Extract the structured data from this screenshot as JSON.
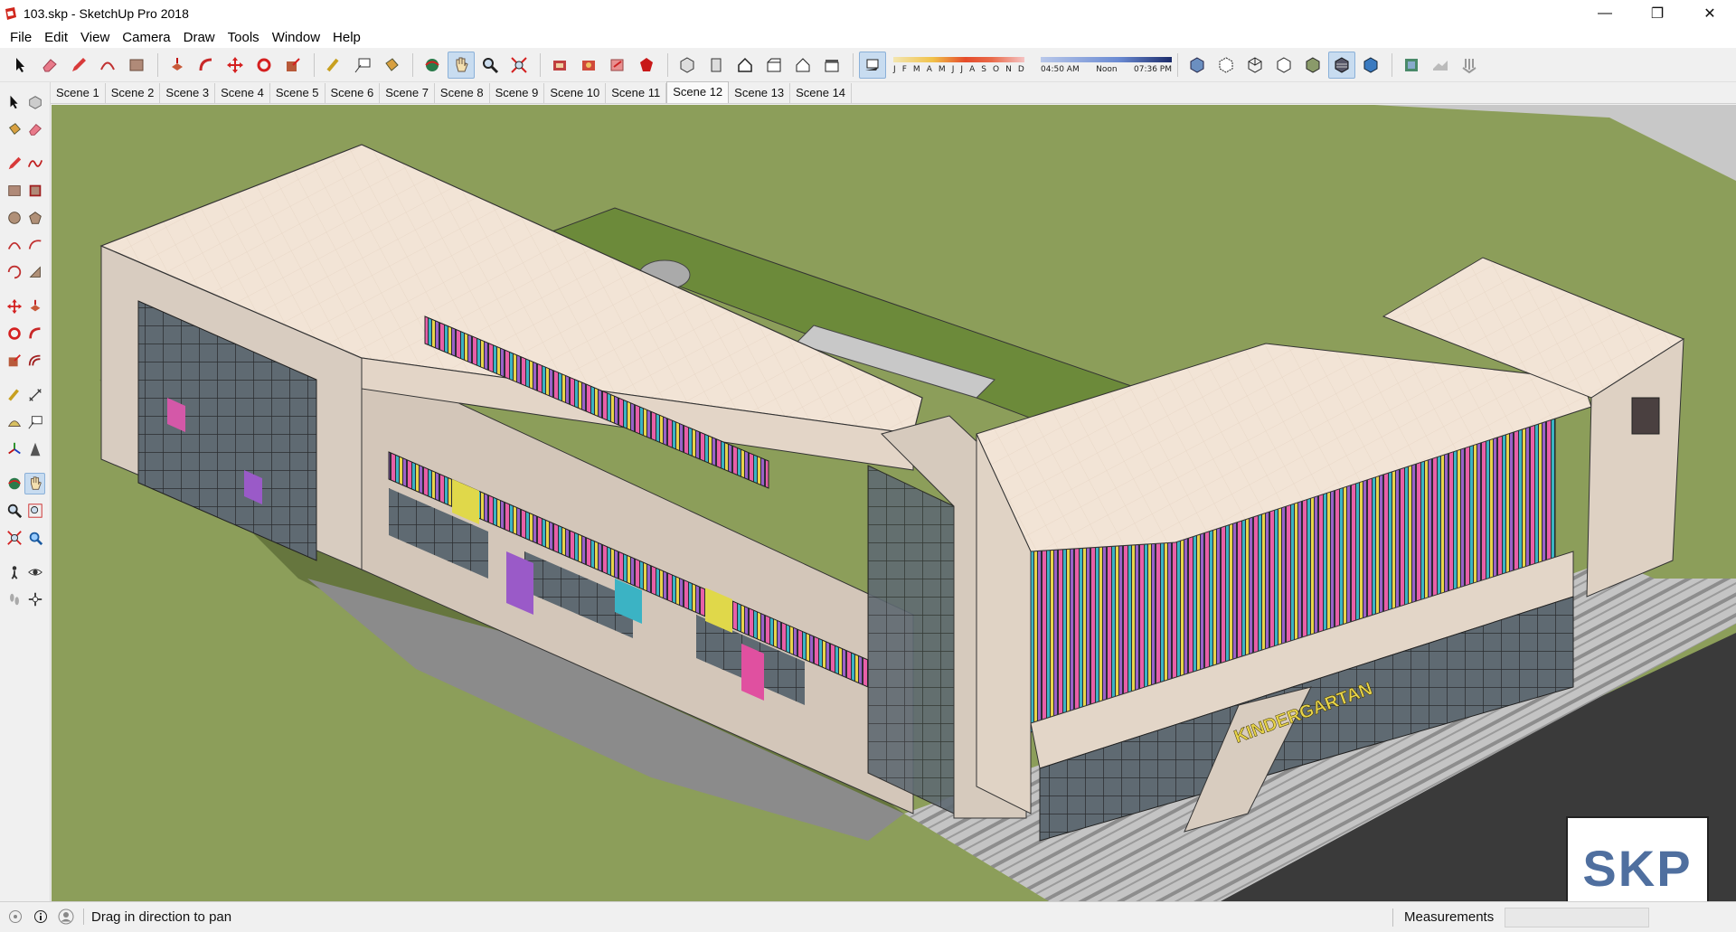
{
  "window": {
    "title": "103.skp - SketchUp Pro 2018",
    "minimize_glyph": "—",
    "restore_glyph": "❐",
    "close_glyph": "✕"
  },
  "menu": [
    "File",
    "Edit",
    "View",
    "Camera",
    "Draw",
    "Tools",
    "Window",
    "Help"
  ],
  "shadows": {
    "months": [
      "J",
      "F",
      "M",
      "A",
      "M",
      "J",
      "J",
      "A",
      "S",
      "O",
      "N",
      "D"
    ],
    "time_start": "04:50 AM",
    "time_mid": "Noon",
    "time_end": "07:36 PM"
  },
  "scenes": {
    "tabs": [
      "Scene 1",
      "Scene 2",
      "Scene 3",
      "Scene 4",
      "Scene 5",
      "Scene 6",
      "Scene 7",
      "Scene 8",
      "Scene 9",
      "Scene 10",
      "Scene 11",
      "Scene 12",
      "Scene 13",
      "Scene 14"
    ],
    "active": "Scene 12"
  },
  "model": {
    "sign": "KINDERGARTAN"
  },
  "watermark": "SKP",
  "status": {
    "hint": "Drag in direction to pan",
    "measurements_label": "Measurements",
    "measurements_value": ""
  },
  "colors": {
    "ground": "#8c9e5a",
    "roof": "#f1e2d4",
    "wall": "#d9cdc1",
    "road": "#3a3a3a",
    "active_tool": "#c8dcf0"
  },
  "icons": {
    "toolbar": [
      "select-icon",
      "eraser-icon",
      "pencil-icon",
      "arc-icon",
      "rectangle-icon",
      "push-pull-icon",
      "follow-me-icon",
      "move-icon",
      "rotate-icon",
      "scale-icon",
      "tape-measure-icon",
      "text-icon",
      "paint-bucket-icon",
      "orbit-icon",
      "pan-icon",
      "zoom-icon",
      "zoom-extents-icon",
      "warehouse-icon",
      "extension-warehouse-icon",
      "send-to-layout-icon",
      "extension-manager-icon",
      "iso-view-icon",
      "top-view-icon",
      "front-view-icon",
      "right-view-icon",
      "back-view-icon",
      "left-view-icon",
      "shadows-toggle-icon",
      "xray-icon",
      "back-edges-icon",
      "wireframe-icon",
      "hidden-line-icon",
      "shaded-icon",
      "shaded-textures-icon",
      "monochrome-icon",
      "geo-location-icon",
      "terrain-icon",
      "sandbox-icon"
    ]
  }
}
